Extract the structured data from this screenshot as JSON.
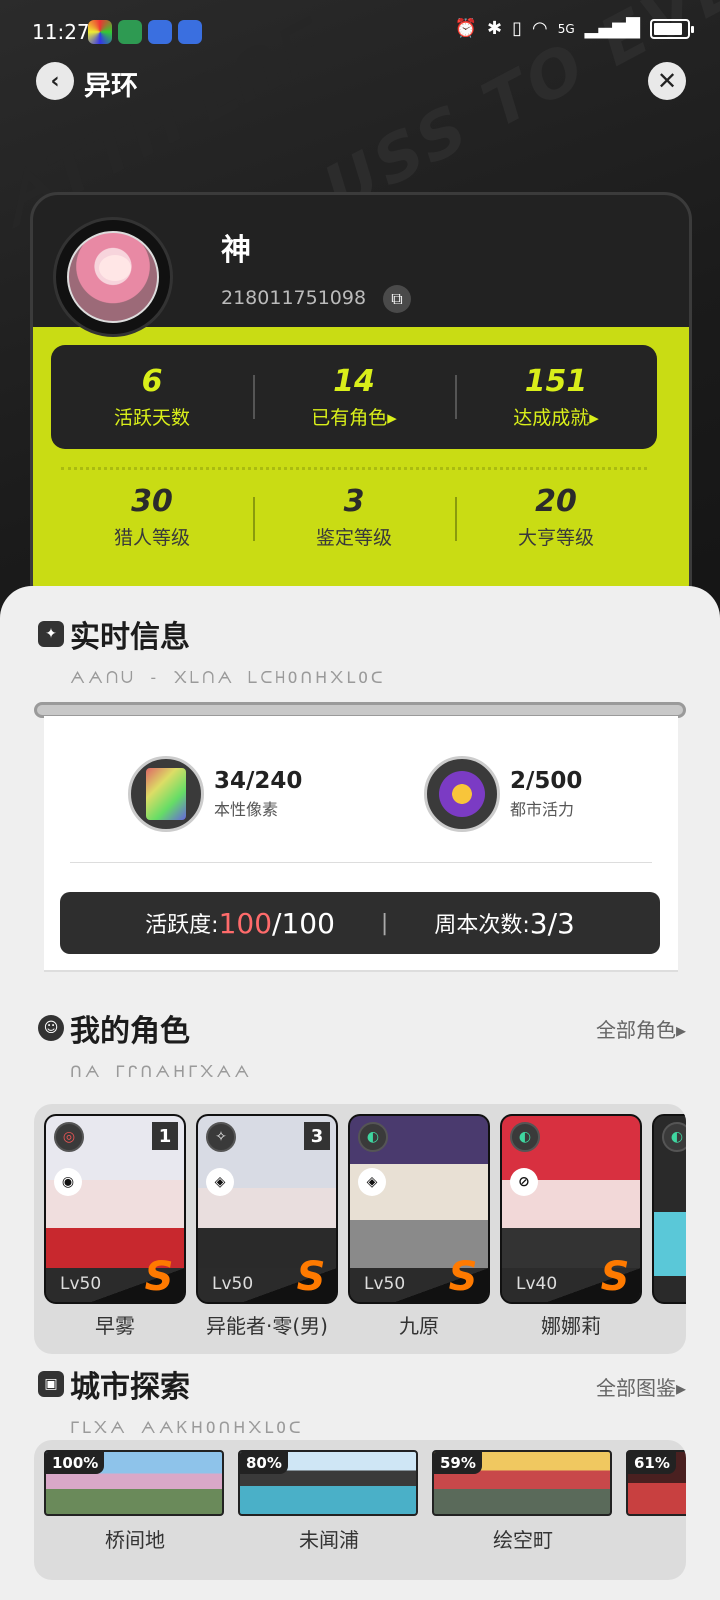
{
  "status_bar": {
    "time": "11:27",
    "network": "5G"
  },
  "header": {
    "title": "异环"
  },
  "profile": {
    "nickname": "神",
    "uid": "218011751098",
    "stats_top": [
      {
        "value": "6",
        "label": "活跃天数"
      },
      {
        "value": "14",
        "label": "已有角色▸"
      },
      {
        "value": "151",
        "label": "达成成就▸"
      }
    ],
    "stats_bottom": [
      {
        "value": "30",
        "label": "猎人等级"
      },
      {
        "value": "3",
        "label": "鉴定等级"
      },
      {
        "value": "20",
        "label": "大亨等级"
      }
    ]
  },
  "realtime": {
    "title": "实时信息",
    "subtitle": "ᗅᗅᑎᑌ - ᙭ᒪᑎᗅ ᒪᑕᕼOᑎᕼ᙭ᒪOᑕ",
    "resources": [
      {
        "value": "34/240",
        "label": "本性像素"
      },
      {
        "value": "2/500",
        "label": "都市活力"
      }
    ],
    "activity_label": "活跃度: ",
    "activity_current": "100",
    "activity_total": "/100",
    "weekly_label": "周本次数: ",
    "weekly_value": "3/3"
  },
  "roles": {
    "title": "我的角色",
    "subtitle": "ᑎᗅ ᒥᒋᑎᗅᕼᒥ᙭ᗅᗅ",
    "link": "全部角色▸",
    "items": [
      {
        "name": "早雾",
        "level": "Lv50",
        "rank": "S",
        "dup": "1"
      },
      {
        "name": "异能者·零(男)",
        "level": "Lv50",
        "rank": "S",
        "dup": "3"
      },
      {
        "name": "九原",
        "level": "Lv50",
        "rank": "S",
        "dup": ""
      },
      {
        "name": "娜娜莉",
        "level": "Lv40",
        "rank": "S",
        "dup": ""
      }
    ]
  },
  "cities": {
    "title": "城市探索",
    "subtitle": "ᒥᒪ᙭ᗅ ᗅᗅᏦᕼOᑎᕼ᙭ᒪOᑕ",
    "link": "全部图鉴▸",
    "items": [
      {
        "name": "桥间地",
        "percent": "100%"
      },
      {
        "name": "未闻浦",
        "percent": "80%"
      },
      {
        "name": "绘空町",
        "percent": "59%"
      },
      {
        "name": "",
        "percent": "61%"
      }
    ]
  }
}
